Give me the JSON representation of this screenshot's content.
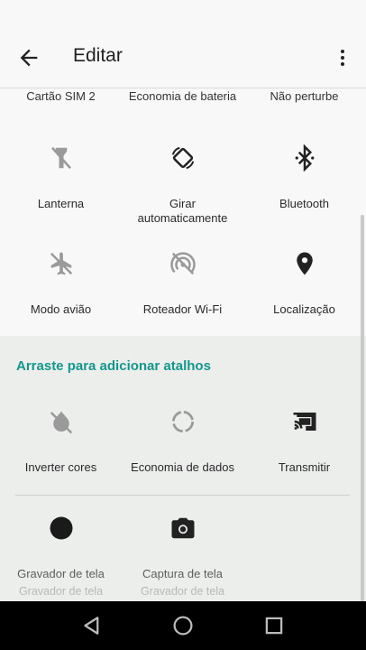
{
  "header": {
    "title": "Editar"
  },
  "prev_row": [
    "Cartão SIM 2",
    "Economia de bateria",
    "Não perturbe"
  ],
  "active_tiles": [
    {
      "label": "Lanterna",
      "icon": "flashlight-off-icon"
    },
    {
      "label": "Girar automaticamente",
      "icon": "screen-rotation-icon"
    },
    {
      "label": "Bluetooth",
      "icon": "bluetooth-icon"
    },
    {
      "label": "Modo avião",
      "icon": "airplane-off-icon"
    },
    {
      "label": "Roteador Wi-Fi",
      "icon": "hotspot-off-icon"
    },
    {
      "label": "Localização",
      "icon": "location-icon"
    }
  ],
  "drag_hint": "Arraste para adicionar atalhos",
  "available_tiles": [
    {
      "label": "Inverter cores",
      "icon": "invert-colors-off-icon"
    },
    {
      "label": "Economia de dados",
      "icon": "data-saver-icon"
    },
    {
      "label": "Transmitir",
      "icon": "cast-icon"
    },
    {
      "label": "Gravador de tela",
      "sub": "Gravador de tela",
      "icon": "screen-record-icon"
    },
    {
      "label": "Captura de tela",
      "sub": "Gravador de tela",
      "icon": "camera-icon"
    }
  ],
  "colors": {
    "accent": "#13978c",
    "icon_active": "#222222",
    "icon_inactive": "#9a9a9a"
  }
}
